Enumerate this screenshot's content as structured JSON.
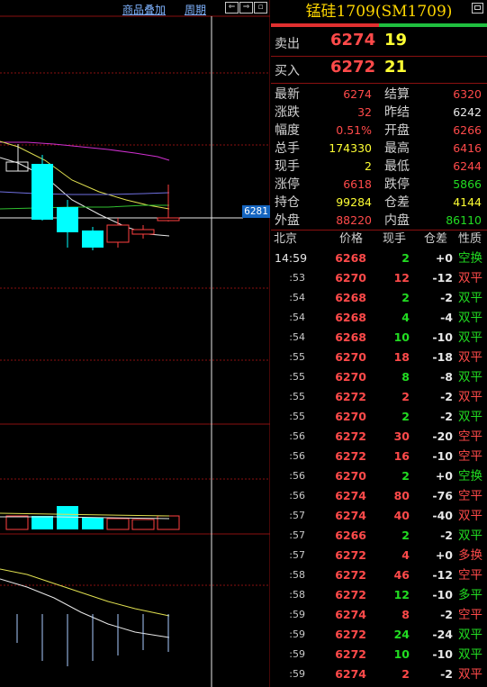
{
  "toolbar": {
    "overlay_label": "商品叠加",
    "period_label": "周期"
  },
  "colors": {
    "up": "#ff4a4a",
    "down": "#22dd22",
    "flat": "#e8e8e8",
    "highlight": "#ffff33",
    "bear_candle": "#00ffff",
    "bull_candle": "#ff4040",
    "grid": "#8a1010"
  },
  "chart": {
    "price_tag": "6281"
  },
  "panel": {
    "title": "锰硅1709(SM1709)",
    "sell_label": "卖出",
    "sell_price": "6274",
    "sell_volume": "19",
    "buy_label": "买入",
    "buy_price": "6272",
    "buy_volume": "21",
    "stats": [
      {
        "l1": "最新",
        "v1": "6274",
        "c1": "red",
        "l2": "结算",
        "v2": "6320",
        "c2": "red"
      },
      {
        "l1": "涨跌",
        "v1": "32",
        "c1": "red",
        "l2": "昨结",
        "v2": "6242",
        "c2": "white"
      },
      {
        "l1": "幅度",
        "v1": "0.51%",
        "c1": "red",
        "l2": "开盘",
        "v2": "6266",
        "c2": "red"
      },
      {
        "l1": "总手",
        "v1": "174330",
        "c1": "yellow",
        "l2": "最高",
        "v2": "6416",
        "c2": "red"
      },
      {
        "l1": "现手",
        "v1": "2",
        "c1": "yellow",
        "l2": "最低",
        "v2": "6244",
        "c2": "red"
      },
      {
        "l1": "涨停",
        "v1": "6618",
        "c1": "red",
        "l2": "跌停",
        "v2": "5866",
        "c2": "green"
      },
      {
        "l1": "持仓",
        "v1": "99284",
        "c1": "yellow",
        "l2": "仓差",
        "v2": "4144",
        "c2": "yellow"
      },
      {
        "l1": "外盘",
        "v1": "88220",
        "c1": "red",
        "l2": "内盘",
        "v2": "86110",
        "c2": "green"
      }
    ],
    "trade_headers": [
      "北京",
      "价格",
      "现手",
      "仓差",
      "性质"
    ],
    "trades": [
      {
        "time": "14:59",
        "price": "6268",
        "vol": "2",
        "diff": "+0",
        "nature": "空换",
        "nc": "green"
      },
      {
        "time": ":53",
        "price": "6270",
        "vol": "12",
        "diff": "-12",
        "nature": "双平",
        "nc": "red"
      },
      {
        "time": ":54",
        "price": "6268",
        "vol": "2",
        "diff": "-2",
        "nature": "双平",
        "nc": "green"
      },
      {
        "time": ":54",
        "price": "6268",
        "vol": "4",
        "diff": "-4",
        "nature": "双平",
        "nc": "green"
      },
      {
        "time": ":54",
        "price": "6268",
        "vol": "10",
        "diff": "-10",
        "nature": "双平",
        "nc": "green"
      },
      {
        "time": ":55",
        "price": "6270",
        "vol": "18",
        "diff": "-18",
        "nature": "双平",
        "nc": "red"
      },
      {
        "time": ":55",
        "price": "6270",
        "vol": "8",
        "diff": "-8",
        "nature": "双平",
        "nc": "green"
      },
      {
        "time": ":55",
        "price": "6272",
        "vol": "2",
        "diff": "-2",
        "nature": "双平",
        "nc": "red"
      },
      {
        "time": ":55",
        "price": "6270",
        "vol": "2",
        "diff": "-2",
        "nature": "双平",
        "nc": "green"
      },
      {
        "time": ":56",
        "price": "6272",
        "vol": "30",
        "diff": "-20",
        "nature": "空平",
        "nc": "red"
      },
      {
        "time": ":56",
        "price": "6272",
        "vol": "16",
        "diff": "-10",
        "nature": "空平",
        "nc": "red"
      },
      {
        "time": ":56",
        "price": "6270",
        "vol": "2",
        "diff": "+0",
        "nature": "空换",
        "nc": "green"
      },
      {
        "time": ":56",
        "price": "6274",
        "vol": "80",
        "diff": "-76",
        "nature": "空平",
        "nc": "red"
      },
      {
        "time": ":57",
        "price": "6274",
        "vol": "40",
        "diff": "-40",
        "nature": "双平",
        "nc": "red"
      },
      {
        "time": ":57",
        "price": "6266",
        "vol": "2",
        "diff": "-2",
        "nature": "双平",
        "nc": "green"
      },
      {
        "time": ":57",
        "price": "6272",
        "vol": "4",
        "diff": "+0",
        "nature": "多换",
        "nc": "red"
      },
      {
        "time": ":58",
        "price": "6272",
        "vol": "46",
        "diff": "-12",
        "nature": "空平",
        "nc": "red"
      },
      {
        "time": ":58",
        "price": "6272",
        "vol": "12",
        "diff": "-10",
        "nature": "多平",
        "nc": "green"
      },
      {
        "time": ":59",
        "price": "6274",
        "vol": "8",
        "diff": "-2",
        "nature": "空平",
        "nc": "red"
      },
      {
        "time": ":59",
        "price": "6272",
        "vol": "24",
        "diff": "-24",
        "nature": "双平",
        "nc": "green"
      },
      {
        "time": ":59",
        "price": "6272",
        "vol": "10",
        "diff": "-10",
        "nature": "双平",
        "nc": "green"
      },
      {
        "time": ":59",
        "price": "6274",
        "vol": "2",
        "diff": "-2",
        "nature": "双平",
        "nc": "red"
      }
    ]
  }
}
